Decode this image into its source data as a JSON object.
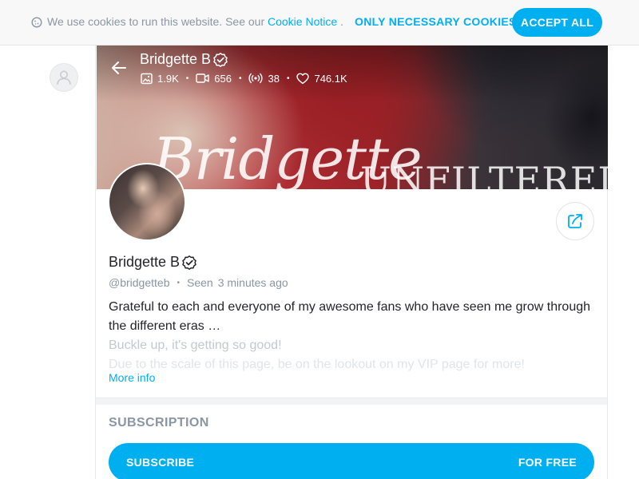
{
  "cookie_bar": {
    "text": "We use cookies to run this website. See our",
    "link": "Cookie Notice",
    "period": ".",
    "only_necessary": "ONLY NECESSARY COOKIES",
    "accept_all": "ACCEPT ALL"
  },
  "banner": {
    "name": "Bridgette B",
    "script_text": "Bridgette",
    "caps_text": "UNFILTERED",
    "stats": {
      "photos": "1.9K",
      "videos": "656",
      "streams": "38",
      "likes": "746.1K"
    }
  },
  "profile": {
    "name": "Bridgette B",
    "handle": "@bridgetteb",
    "seen_label": "Seen",
    "seen_time": "3 minutes ago",
    "bio": {
      "line1": "Grateful to each and everyone of my awesome fans who have seen me grow through the different eras …",
      "line2": "Buckle up, it's getting so good!",
      "line3": "Due to the scale of this page, be on the lookout on my VIP page for more!"
    },
    "more_info": "More info"
  },
  "subscription": {
    "title": "SUBSCRIPTION",
    "button_label": "SUBSCRIBE",
    "button_price": "FOR FREE"
  },
  "colors": {
    "accent": "#00aff0",
    "muted": "#8a96a3",
    "text": "#242529"
  }
}
